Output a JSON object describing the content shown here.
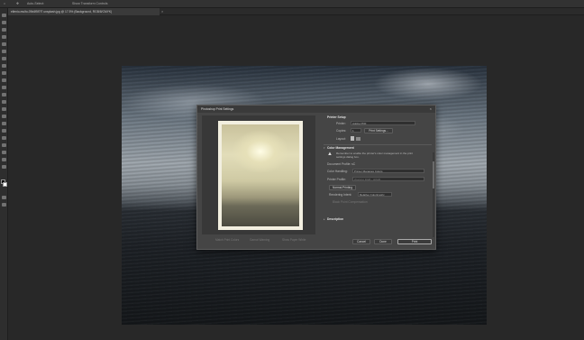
{
  "options_bar": {
    "items": [
      "Auto-Select:",
      "Show Transform Controls"
    ]
  },
  "document": {
    "tab_title": "ellenio-multo-09d4f5f7f7 unsplash.jpg @ 17.5% (Background, RGB/8/CMYK)"
  },
  "dialog": {
    "title": "Photoshop Print Settings",
    "preview_links": [
      "Match Print Colors",
      "Gamut Warning",
      "Show Paper White"
    ],
    "printer_setup": {
      "title": "Printer Setup",
      "printer_label": "Printer:",
      "printer_value": "Adobe PDF",
      "copies_label": "Copies:",
      "copies_value": "1",
      "print_settings_label": "Print Settings...",
      "layout_label": "Layout:"
    },
    "color_management": {
      "title": "Color Management",
      "warning_text": "Remember to enable the printer's color management in the print settings dialog box.",
      "doc_profile_label": "Document Profile: sC",
      "color_handling_label": "Color Handling:",
      "color_handling_value": "Printer Manages Colors",
      "printer_profile_label": "Printer Profile:",
      "printer_profile_value": "Working RGB - sRGB",
      "normal_printing": "Normal Printing",
      "rendering_intent_label": "Rendering Intent:",
      "rendering_intent_value": "Relative Colorimetric",
      "black_point_label": "Black Point Compensation"
    },
    "description_title": "Description",
    "cancel_label": "Cancel",
    "done_label": "Done",
    "print_label": "Print"
  }
}
